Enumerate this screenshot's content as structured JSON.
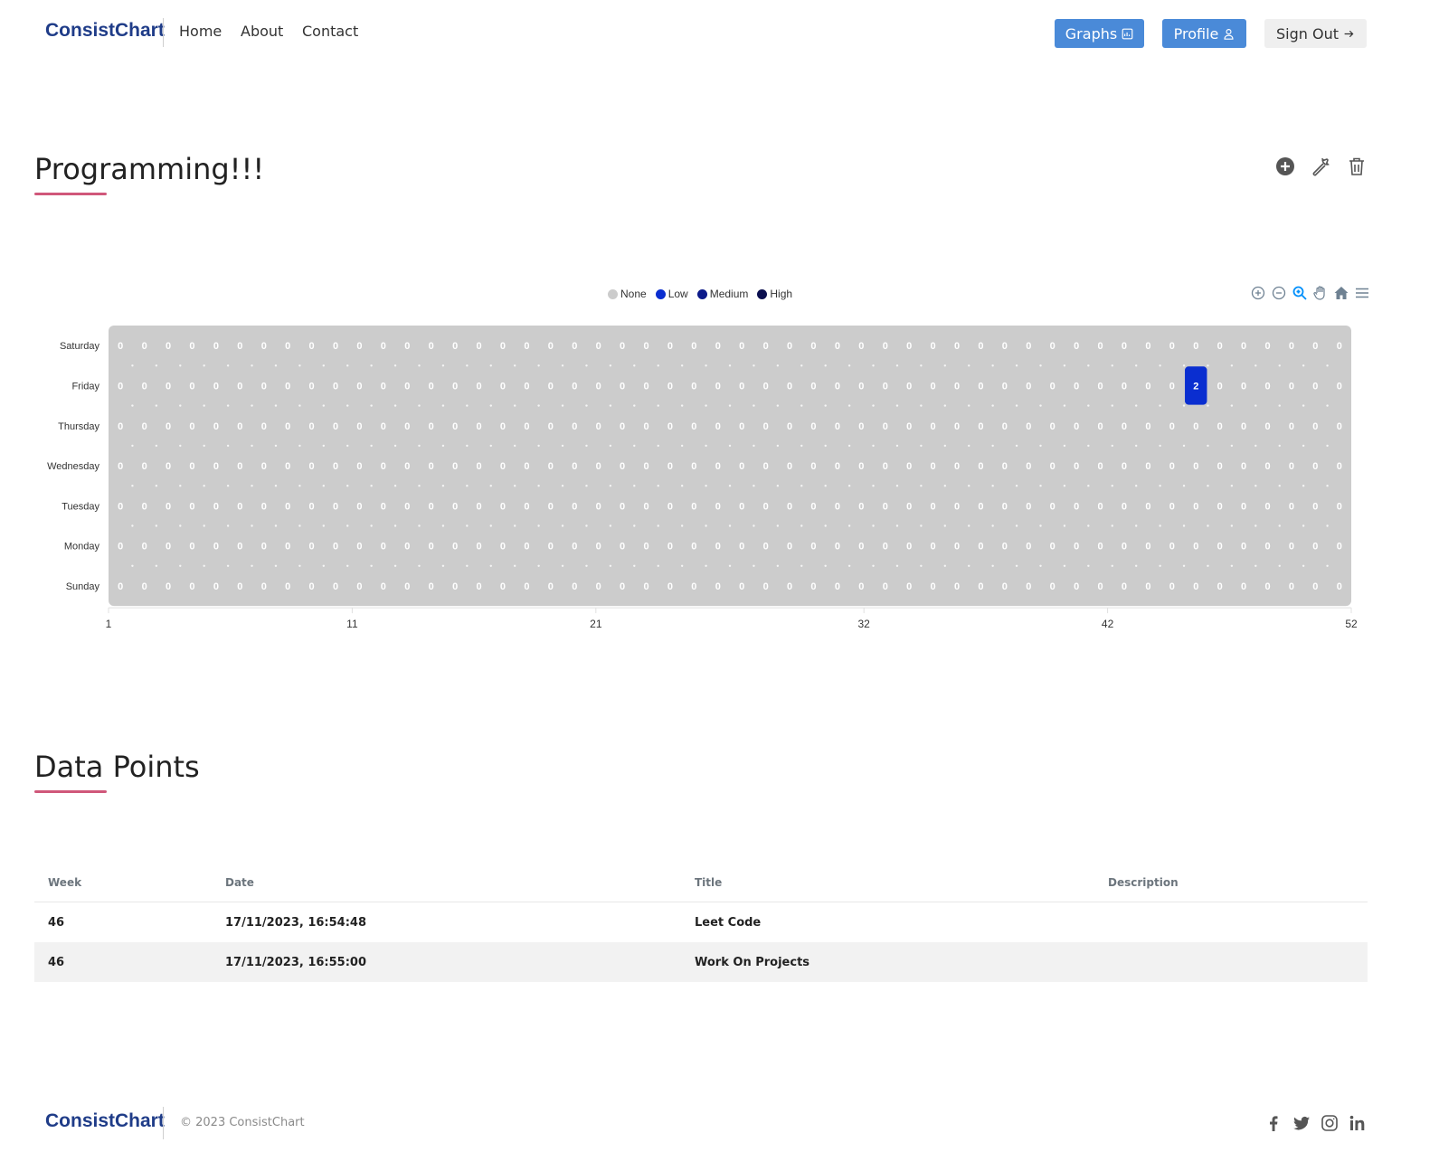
{
  "nav": {
    "brand": "ConsistChart",
    "links": [
      "Home",
      "About",
      "Contact"
    ],
    "graphs_label": "Graphs",
    "profile_label": "Profile",
    "signout_label": "Sign Out"
  },
  "chart_section": {
    "title": "Programming!!!",
    "actions": [
      "add-icon",
      "wrench-icon",
      "trash-icon"
    ]
  },
  "chart_data": {
    "type": "heatmap",
    "rows": [
      "Saturday",
      "Friday",
      "Thursday",
      "Wednesday",
      "Tuesday",
      "Monday",
      "Sunday"
    ],
    "weeks": 52,
    "xticks": [
      "1",
      "11",
      "21",
      "32",
      "42",
      "52"
    ],
    "default_value": 0,
    "nonzero": [
      {
        "row": "Friday",
        "week": 46,
        "value": 2
      }
    ],
    "legend": [
      {
        "name": "None",
        "color": "#cccccc"
      },
      {
        "name": "Low",
        "color": "#0a2ed0"
      },
      {
        "name": "Medium",
        "color": "#0c1a8a"
      },
      {
        "name": "High",
        "color": "#0b0f4f"
      }
    ],
    "toolbar": [
      "zoom-in-icon",
      "zoom-out-icon",
      "selection-zoom-icon",
      "pan-hand-icon",
      "reset-home-icon",
      "menu-icon"
    ]
  },
  "data_points": {
    "title": "Data Points",
    "columns": [
      "Week",
      "Date",
      "Title",
      "Description"
    ],
    "rows": [
      {
        "week": "46",
        "date": "17/11/2023, 16:54:48",
        "title": "Leet Code",
        "description": ""
      },
      {
        "week": "46",
        "date": "17/11/2023, 16:55:00",
        "title": "Work On Projects",
        "description": ""
      }
    ]
  },
  "footer": {
    "brand": "ConsistChart",
    "copyright": "© 2023 ConsistChart",
    "social": [
      "facebook-icon",
      "twitter-icon",
      "instagram-icon",
      "linkedin-icon"
    ]
  }
}
